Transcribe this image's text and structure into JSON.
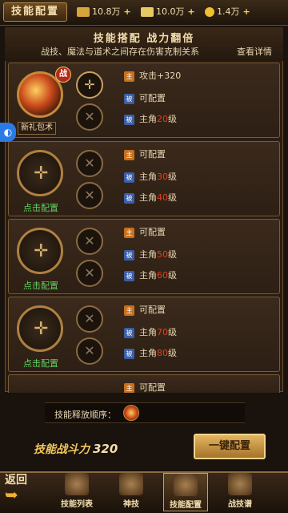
{
  "header": {
    "title": "技能配置",
    "resources": [
      {
        "icon": "gold-ingot-icon",
        "value": "10.8万"
      },
      {
        "icon": "bound-gold-icon",
        "value": "10.0万"
      },
      {
        "icon": "coin-icon",
        "value": "1.4万"
      }
    ],
    "plus": "+"
  },
  "banner": {
    "title": "技能搭配 战力翻倍",
    "subtitle": "战技、魔法与道术之间存在伤害克制关系",
    "link": "查看详情"
  },
  "rows": [
    {
      "click_label": "",
      "badge": "战",
      "lines": [
        {
          "text": "攻击+320",
          "lv": ""
        },
        {
          "text": "可配置",
          "lv": ""
        },
        {
          "text": "主角",
          "lv": "20",
          "suffix": "级"
        }
      ]
    },
    {
      "click_label": "点击配置",
      "lines": [
        {
          "text": "可配置",
          "lv": ""
        },
        {
          "text": "主角",
          "lv": "30",
          "suffix": "级"
        },
        {
          "text": "主角",
          "lv": "40",
          "suffix": "级"
        }
      ]
    },
    {
      "click_label": "点击配置",
      "lines": [
        {
          "text": "可配置",
          "lv": ""
        },
        {
          "text": "主角",
          "lv": "50",
          "suffix": "级"
        },
        {
          "text": "主角",
          "lv": "60",
          "suffix": "级"
        }
      ]
    },
    {
      "click_label": "点击配置",
      "lines": [
        {
          "text": "可配置",
          "lv": ""
        },
        {
          "text": "主角",
          "lv": "70",
          "suffix": "级"
        },
        {
          "text": "主角",
          "lv": "80",
          "suffix": "级"
        }
      ]
    },
    {
      "click_label": "",
      "lines": [
        {
          "text": "可配置",
          "lv": ""
        }
      ]
    }
  ],
  "gift": {
    "label": "新礼包",
    "tail": "术"
  },
  "tag_labels": {
    "orange": "主",
    "blue": "被"
  },
  "order": {
    "label": "技能释放顺序："
  },
  "power": {
    "label": "技能战斗力",
    "value": "320"
  },
  "config_button": "一键配置",
  "nav": {
    "back": "返回",
    "items": [
      {
        "label": "技能列表"
      },
      {
        "label": "神技"
      },
      {
        "label": "技能配置"
      },
      {
        "label": "战技谱"
      }
    ]
  }
}
